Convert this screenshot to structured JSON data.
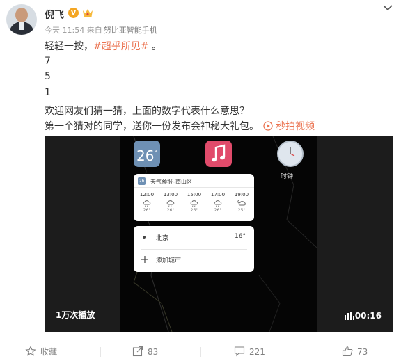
{
  "post": {
    "username": "倪飞",
    "verified_badge": "V",
    "time": "今天 11:54",
    "source_prefix": "来自",
    "source": "努比亚智能手机",
    "line1_prefix": "轻轻一按，",
    "hashtag": "#超乎所见#",
    "line1_suffix": " 。",
    "line2": "7",
    "line3": "5",
    "line4": "1",
    "line5": "欢迎网友们猜一猜，上面的数字代表什么意思？",
    "line6": "第一个猜对的同学，送你一份发布会神秘大礼包。",
    "video_link_label": "秒拍视频"
  },
  "video": {
    "views": "1万次播放",
    "duration": "00:16",
    "weather_app_temp": "26",
    "weather_app_deg": "°",
    "clock_label": "时钟",
    "forecast_card": {
      "badge": "2b",
      "title": "天气预报–南山区",
      "slots": [
        {
          "time": "12:00",
          "temp": "26°",
          "icon": "cloud-rain-icon"
        },
        {
          "time": "13:00",
          "temp": "26°",
          "icon": "cloud-rain-icon"
        },
        {
          "time": "15:00",
          "temp": "26°",
          "icon": "cloud-rain-icon"
        },
        {
          "time": "17:00",
          "temp": "26°",
          "icon": "cloud-rain-icon"
        },
        {
          "time": "19:00",
          "temp": "25°",
          "icon": "cloudy-night-icon"
        }
      ]
    },
    "city_card": {
      "city": "北京",
      "temp": "16°",
      "add_label": "添加城市"
    }
  },
  "actions": {
    "favorite": "收藏",
    "share_count": "83",
    "comment_count": "221",
    "like_count": "73"
  },
  "colors": {
    "accent": "#eb7350",
    "meta": "#999999",
    "video_bg": "#1c1c1c"
  }
}
